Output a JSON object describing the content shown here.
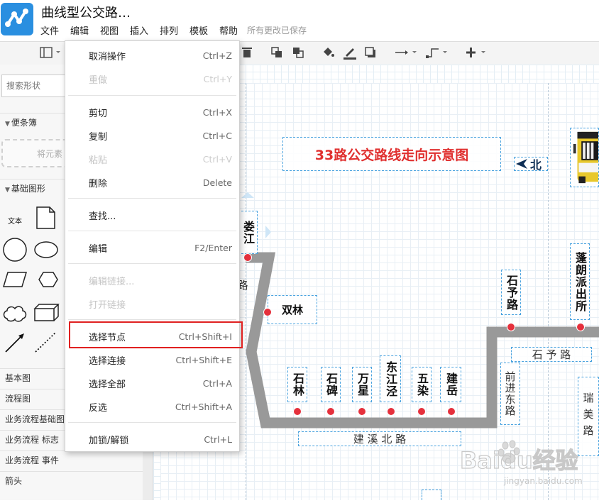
{
  "app": {
    "title": "曲线型公交路…",
    "menu": [
      "文件",
      "编辑",
      "视图",
      "插入",
      "排列",
      "模板",
      "帮助"
    ],
    "save_status": "所有更改已保存"
  },
  "sidebar": {
    "search_placeholder": "搜索形状",
    "categories": {
      "notes": "便条簿",
      "basic_shapes": "基础图形",
      "basic": "基本图",
      "flowchart": "流程图",
      "bpmn_basic": "业务流程基础图",
      "bpmn_marker": "业务流程 标志",
      "bpmn_event": "业务流程 事件",
      "arrow": "箭头"
    },
    "drop_hint": "将元素",
    "shape_text": "文本"
  },
  "context_menu": {
    "items": [
      {
        "label": "取消操作",
        "shortcut": "Ctrl+Z",
        "enabled": true
      },
      {
        "label": "重做",
        "shortcut": "Ctrl+Y",
        "enabled": false
      },
      {
        "label": "剪切",
        "shortcut": "Ctrl+X",
        "enabled": true
      },
      {
        "label": "复制",
        "shortcut": "Ctrl+C",
        "enabled": true
      },
      {
        "label": "粘贴",
        "shortcut": "Ctrl+V",
        "enabled": false
      },
      {
        "label": "删除",
        "shortcut": "Delete",
        "enabled": true
      },
      {
        "label": "查找...",
        "shortcut": "",
        "enabled": true
      },
      {
        "label": "编辑",
        "shortcut": "F2/Enter",
        "enabled": true
      },
      {
        "label": "编辑链接...",
        "shortcut": "",
        "enabled": false
      },
      {
        "label": "打开链接",
        "shortcut": "",
        "enabled": false
      },
      {
        "label": "选择节点",
        "shortcut": "Ctrl+Shift+I",
        "enabled": true,
        "highlighted": true
      },
      {
        "label": "选择连接",
        "shortcut": "Ctrl+Shift+E",
        "enabled": true
      },
      {
        "label": "选择全部",
        "shortcut": "Ctrl+A",
        "enabled": true
      },
      {
        "label": "反选",
        "shortcut": "Ctrl+Shift+A",
        "enabled": true
      },
      {
        "label": "加锁/解锁",
        "shortcut": "Ctrl+L",
        "enabled": true
      }
    ]
  },
  "canvas": {
    "title": "33路公交路线走向示意图",
    "title_color": "#e0302f",
    "north": "北",
    "stops": {
      "loujiang": "娄江",
      "shuanglin": "双林",
      "shilin": "石林",
      "shibei": "石碑",
      "wanxing": "万星",
      "dongjiangjing": "东江泾",
      "wuran": "五染",
      "jianyue": "建岳",
      "shiyulu": "石予路",
      "penglang": "蓬朗派出所"
    },
    "roads": {
      "jianxibeilu": "建 溪 北 路",
      "shiyulu_road": "石 予 路",
      "qianjindonglu": "前进东路",
      "ruimeilu": "瑞美路",
      "lu_partial": "路"
    },
    "stop_color": "#e5303c",
    "route_color": "#999999"
  },
  "watermark": {
    "text": "Baidu经验",
    "sub": "jingyan.baidu.com"
  }
}
